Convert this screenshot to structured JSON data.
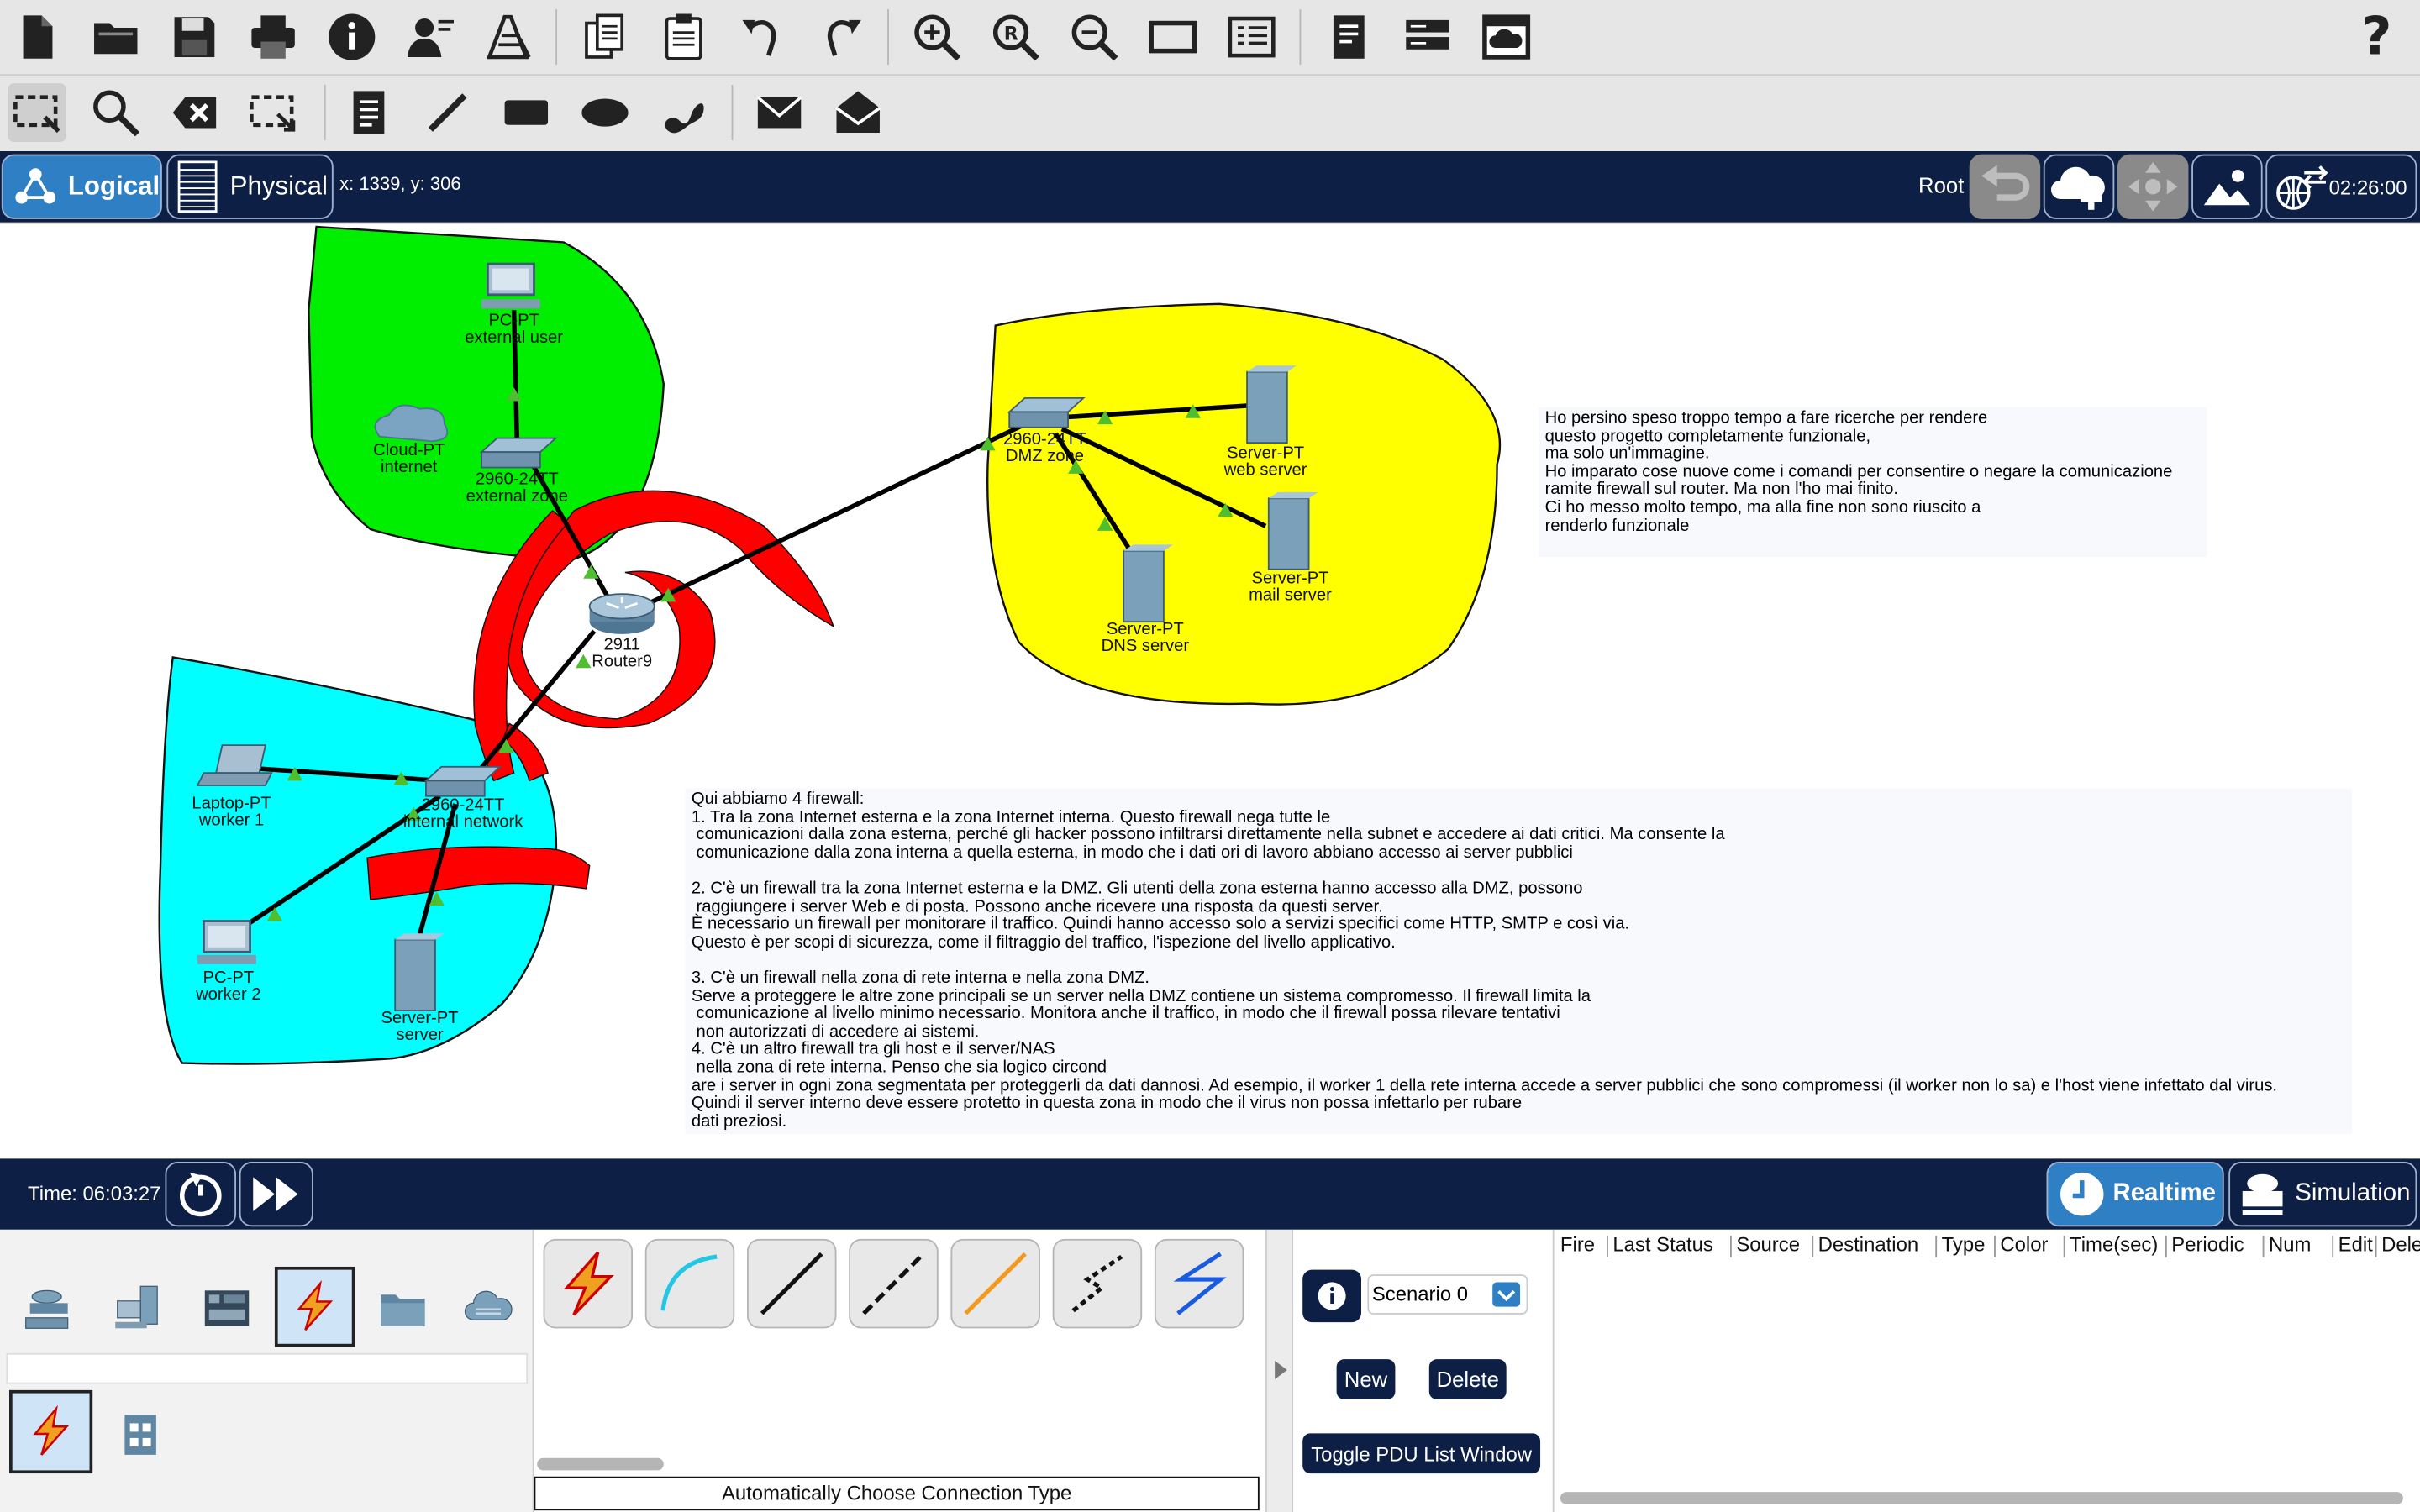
{
  "toolbar": {
    "help_label": "?"
  },
  "tabs": {
    "logical": "Logical",
    "physical": "Physical"
  },
  "coords": "x: 1339, y: 306",
  "nav_right": {
    "root": "Root",
    "clock": "02:26:00"
  },
  "devices": {
    "pc_external": {
      "type": "PC-PT",
      "name": "external user"
    },
    "cloud": {
      "type": "Cloud-PT",
      "name": "internet"
    },
    "switch_external": {
      "type": "2960-24TT",
      "name": "external zone"
    },
    "router": {
      "type": "2911",
      "name": "Router9"
    },
    "switch_dmz": {
      "type": "2960-24TT",
      "name": "DMZ zone"
    },
    "web_server": {
      "type": "Server-PT",
      "name": "web server"
    },
    "mail_server": {
      "type": "Server-PT",
      "name": "mail server"
    },
    "dns_server": {
      "type": "Server-PT",
      "name": "DNS server"
    },
    "laptop": {
      "type": "Laptop-PT",
      "name": "worker 1"
    },
    "switch_internal": {
      "type": "2960-24TT",
      "name": "internal network"
    },
    "pc_worker2": {
      "type": "PC-PT",
      "name": "worker 2"
    },
    "server_internal": {
      "type": "Server-PT",
      "name": "server"
    }
  },
  "note_right": "Ho persino speso troppo tempo a fare ricerche per rendere\nquesto progetto completamente funzionale,\nma solo un'immagine.\nHo imparato cose nuove come i comandi per consentire o negare la comunicazione\nramite firewall sul router. Ma non l'ho mai finito.\nCi ho messo molto tempo, ma alla fine non sono riuscito a\nrenderlo funzionale",
  "note_bottom": "Qui abbiamo 4 firewall:\n1. Tra la zona Internet esterna e la zona Internet interna. Questo firewall nega tutte le\n comunicazioni dalla zona esterna, perché gli hacker possono infiltrarsi direttamente nella subnet e accedere ai dati critici. Ma consente la\n comunicazione dalla zona interna a quella esterna, in modo che i dati ori di lavoro abbiano accesso ai server pubblici\n\n2. C'è un firewall tra la zona Internet esterna e la DMZ. Gli utenti della zona esterna hanno accesso alla DMZ, possono\n raggiungere i server Web e di posta. Possono anche ricevere una risposta da questi server.\nÈ necessario un firewall per monitorare il traffico. Quindi hanno accesso solo a servizi specifici come HTTP, SMTP e così via.\nQuesto è per scopi di sicurezza, come il filtraggio del traffico, l'ispezione del livello applicativo.\n\n3. C'è un firewall nella zona di rete interna e nella zona DMZ.\nServe a proteggere le altre zone principali se un server nella DMZ contiene un sistema compromesso. Il firewall limita la\n comunicazione al livello minimo necessario. Monitora anche il traffico, in modo che il firewall possa rilevare tentativi\n non autorizzati di accedere ai sistemi.\n4. C'è un altro firewall tra gli host e il server/NAS\n nella zona di rete interna. Penso che sia logico circond\nare i server in ogni zona segmentata per proteggerli da dati dannosi. Ad esempio, il worker 1 della rete interna accede a server pubblici che sono compromessi (il worker non lo sa) e l'host viene infettato dal virus.\nQuindi il server interno deve essere protetto in questa zona in modo che il virus non possa infettarlo per rubare\ndati preziosi.",
  "time_bar": {
    "time": "Time: 06:03:27",
    "realtime": "Realtime",
    "simulation": "Simulation"
  },
  "connections": {
    "status": "Automatically Choose Connection Type"
  },
  "scenario": {
    "selected": "Scenario 0",
    "new_label": "New",
    "delete_label": "Delete",
    "toggle_label": "Toggle PDU List Window"
  },
  "pdu_columns": [
    "Fire",
    "Last Status",
    "Source",
    "Destination",
    "Type",
    "Color",
    "Time(sec)",
    "Periodic",
    "Num",
    "Edit",
    "Delete"
  ],
  "colors": {
    "nav_bg": "#0d1f45",
    "accent": "#2e7fc4",
    "zone_external": "#00ee00",
    "zone_dmz": "#ffff00",
    "zone_internal": "#00ffff",
    "firewall": "#ff0000"
  }
}
